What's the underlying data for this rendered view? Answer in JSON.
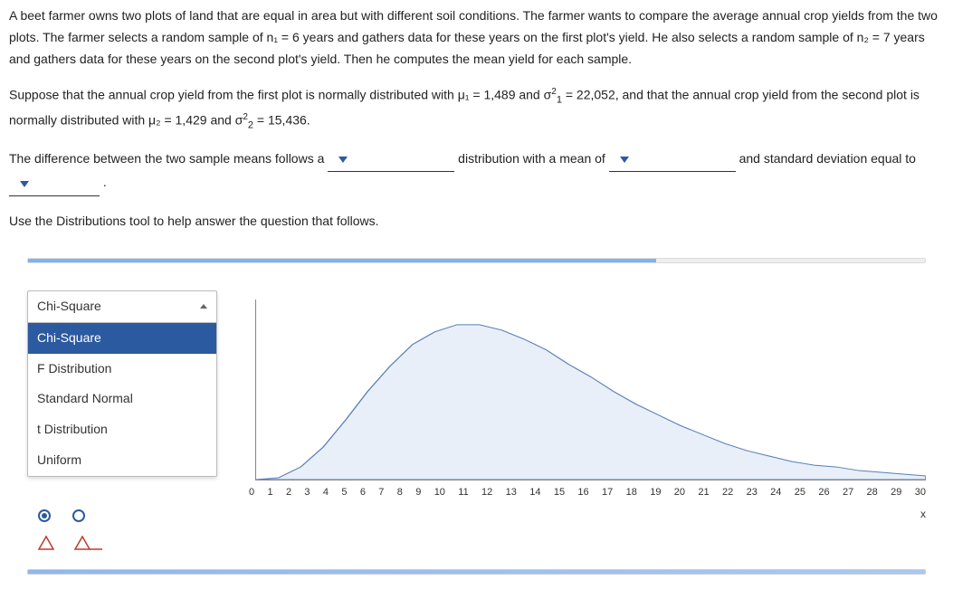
{
  "problem": {
    "p1": "A beet farmer owns two plots of land that are equal in area but with different soil conditions. The farmer wants to compare the average annual crop yields from the two plots. The farmer selects a random sample of n₁ = 6 years and gathers data for these years on the first plot's yield. He also selects a random sample of n₂ = 7 years and gathers data for these years on the second plot's yield. Then he computes the mean yield for each sample.",
    "p2_a": "Suppose that the annual crop yield from the first plot is normally distributed with μ₁ = 1,489 and σ",
    "p2_b": " = 22,052, and that the annual crop yield from the second plot is normally distributed with μ₂ = 1,429 and σ",
    "p2_c": " = 15,436.",
    "fill_a": "The difference between the two sample means follows a ",
    "fill_b": " distribution with a mean of ",
    "fill_c": " and standard deviation equal to ",
    "period": " .",
    "instr": "Use the Distributions tool to help answer the question that follows."
  },
  "tool": {
    "selected": "Chi-Square",
    "options": [
      "Chi-Square",
      "F Distribution",
      "Standard Normal",
      "t Distribution",
      "Uniform"
    ]
  },
  "chart_data": {
    "type": "area",
    "title": "",
    "xlabel": "x",
    "ylabel": "",
    "xlim": [
      0,
      30
    ],
    "ylim": [
      0,
      0.1
    ],
    "x": [
      0,
      1,
      2,
      3,
      4,
      5,
      6,
      7,
      8,
      9,
      10,
      11,
      12,
      13,
      14,
      15,
      16,
      17,
      18,
      19,
      20,
      21,
      22,
      23,
      24,
      25,
      26,
      27,
      28,
      29,
      30
    ],
    "values": [
      0,
      0.001,
      0.007,
      0.018,
      0.033,
      0.049,
      0.063,
      0.075,
      0.082,
      0.086,
      0.086,
      0.083,
      0.078,
      0.072,
      0.064,
      0.057,
      0.049,
      0.042,
      0.036,
      0.03,
      0.025,
      0.02,
      0.016,
      0.013,
      0.01,
      0.008,
      0.007,
      0.005,
      0.004,
      0.003,
      0.002
    ],
    "ticks": [
      "0",
      "1",
      "2",
      "3",
      "4",
      "5",
      "6",
      "7",
      "8",
      "9",
      "10",
      "11",
      "12",
      "13",
      "14",
      "15",
      "16",
      "17",
      "18",
      "19",
      "20",
      "21",
      "22",
      "23",
      "24",
      "25",
      "26",
      "27",
      "28",
      "29",
      "30"
    ]
  }
}
